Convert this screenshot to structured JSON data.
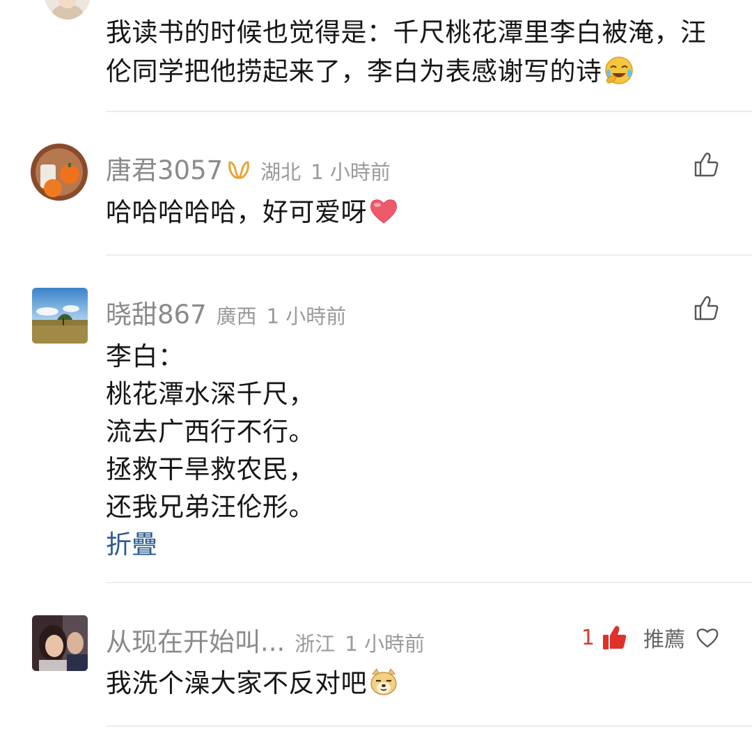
{
  "comments": [
    {
      "text_lines": [
        "我读书的时候也觉得是：千尺桃花潭里李白被淹，汪",
        "伦同学把他捞起来了，李白为表感谢写的诗"
      ],
      "trailing_emoji": "laugh-cry-emoji"
    },
    {
      "username": "唐君3057",
      "badge": "membership-badge-icon",
      "location": "湖北",
      "time": "1 小時前",
      "text_lines": [
        "哈哈哈哈哈，好可爱呀"
      ],
      "trailing_emoji": "heart-emoji"
    },
    {
      "username": "晓甜867",
      "location": "廣西",
      "time": "1 小時前",
      "text_lines": [
        "李白：",
        "桃花潭水深千尺，",
        "流去广西行不行。",
        "拯救干旱救农民，",
        "还我兄弟汪伦形。"
      ],
      "collapse_label": "折疊"
    },
    {
      "username": "从现在开始叫...",
      "location": "浙江",
      "time": "1 小時前",
      "like_count": "1",
      "recommend_label": "推薦",
      "text_lines": [
        "我洗个澡大家不反对吧"
      ],
      "trailing_emoji": "doge-emoji"
    }
  ],
  "colors": {
    "like_active": "#e0302a",
    "link": "#2d5b8f",
    "badge": "#e6a33a"
  }
}
